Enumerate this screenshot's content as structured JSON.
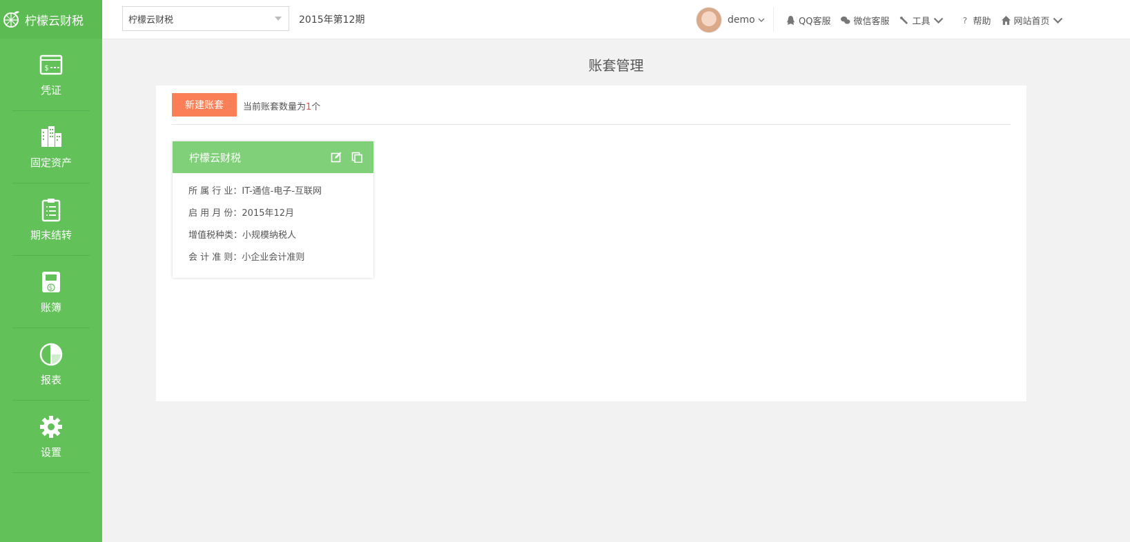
{
  "app": {
    "brand": "柠檬云财税"
  },
  "sidebar": {
    "items": [
      {
        "label": "凭证",
        "icon": "voucher-icon"
      },
      {
        "label": "固定资产",
        "icon": "buildings-icon"
      },
      {
        "label": "期末结转",
        "icon": "clipboard-icon"
      },
      {
        "label": "账簿",
        "icon": "ledger-book-icon"
      },
      {
        "label": "报表",
        "icon": "pie-chart-icon"
      },
      {
        "label": "设置",
        "icon": "gear-icon"
      }
    ]
  },
  "topbar": {
    "company_select": "柠檬云财税",
    "period": "2015年第12期",
    "user": "demo",
    "links": {
      "qq": "QQ客服",
      "wechat": "微信客服",
      "tools": "工具",
      "help": "帮助",
      "home": "网站首页"
    }
  },
  "main": {
    "title": "账套管理",
    "new_button": "新建账套",
    "count_prefix": "当前账套数量为",
    "count": "1",
    "count_suffix": "个",
    "cards": [
      {
        "name": "柠檬云财税",
        "rows": [
          {
            "label": "所 属 行 业",
            "value": "：IT-通信-电子-互联网"
          },
          {
            "label": "启 用 月 份",
            "value": "：2015年12月"
          },
          {
            "label": "增值税种类",
            "value": "：小规模纳税人"
          },
          {
            "label": "会 计 准 则",
            "value": "：小企业会计准则"
          }
        ]
      }
    ]
  },
  "colors": {
    "sidebar": "#63c15a",
    "card_header": "#80d079",
    "primary_button": "#fa7f57",
    "count_highlight": "#ff4444"
  }
}
